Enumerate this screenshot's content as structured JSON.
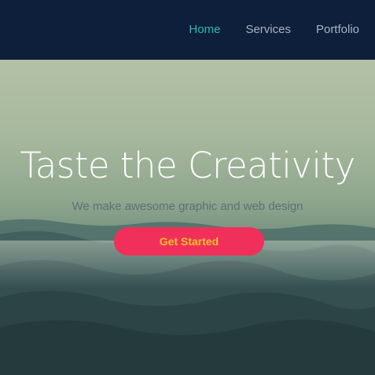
{
  "nav": {
    "items": [
      {
        "label": "Home",
        "active": true
      },
      {
        "label": "Services",
        "active": false
      },
      {
        "label": "Portfolio",
        "active": false
      }
    ]
  },
  "hero": {
    "title": "Taste the Creativity",
    "subtitle": "We make awesome graphic and web design",
    "cta_label": "Get Started",
    "background": "misty-mountain-landscape"
  },
  "colors": {
    "navbar_bg": "#0d1f3b",
    "nav_active": "#2bb9b0",
    "nav_inactive": "#a9b3c2",
    "cta_bg": "#f0305a",
    "cta_text": "#f7c028"
  }
}
